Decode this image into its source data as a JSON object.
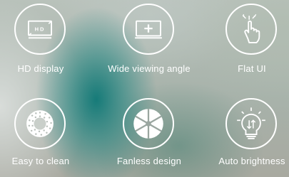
{
  "features": [
    {
      "label": "HD display",
      "icon": "hd-monitor-icon",
      "badge": "HD"
    },
    {
      "label": "Wide viewing angle",
      "icon": "monitor-plus-icon"
    },
    {
      "label": "Flat UI",
      "icon": "touch-hand-icon"
    },
    {
      "label": "Easy to clean",
      "icon": "vent-grille-icon"
    },
    {
      "label": "Fanless design",
      "icon": "fan-blades-icon"
    },
    {
      "label": "Auto brightness",
      "icon": "bulb-icon"
    }
  ]
}
